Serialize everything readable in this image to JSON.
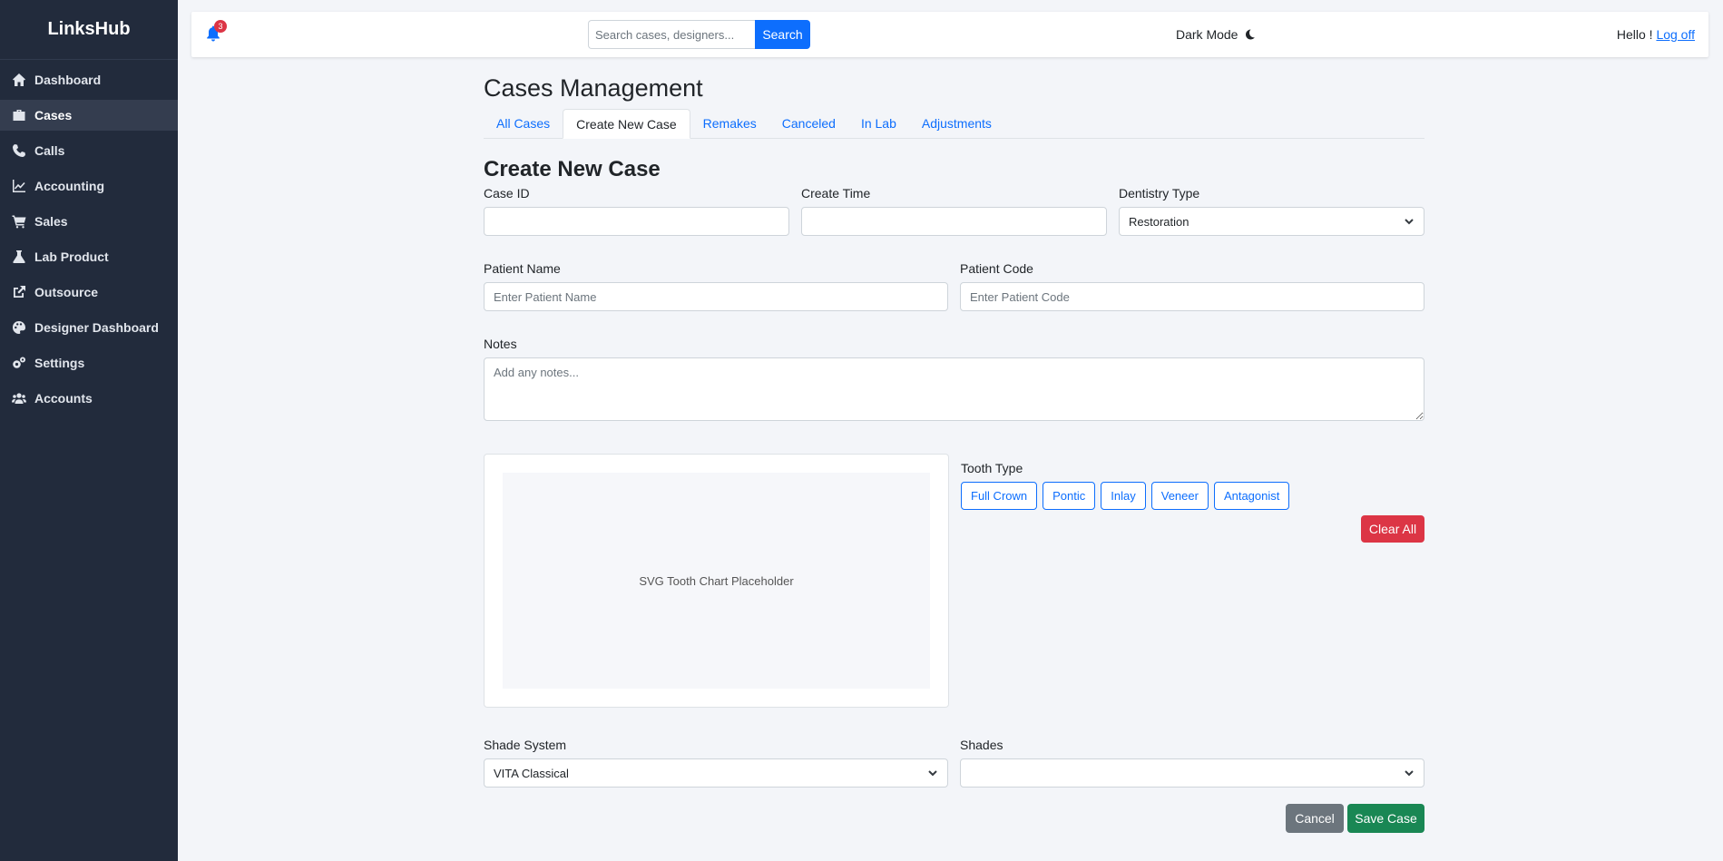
{
  "app": {
    "brand": "LinksHub"
  },
  "sidebar": {
    "items": [
      {
        "label": "Dashboard",
        "icon": "home-icon",
        "active": false
      },
      {
        "label": "Cases",
        "icon": "briefcase-icon",
        "active": true
      },
      {
        "label": "Calls",
        "icon": "phone-icon",
        "active": false
      },
      {
        "label": "Accounting",
        "icon": "chart-line-icon",
        "active": false
      },
      {
        "label": "Sales",
        "icon": "cart-icon",
        "active": false
      },
      {
        "label": "Lab Product",
        "icon": "flask-icon",
        "active": false
      },
      {
        "label": "Outsource",
        "icon": "external-link-icon",
        "active": false
      },
      {
        "label": "Designer Dashboard",
        "icon": "palette-icon",
        "active": false
      },
      {
        "label": "Settings",
        "icon": "gears-icon",
        "active": false
      },
      {
        "label": "Accounts",
        "icon": "users-icon",
        "active": false
      }
    ]
  },
  "topbar": {
    "notification_count": "3",
    "search_placeholder": "Search cases, designers...",
    "search_button": "Search",
    "dark_mode_label": "Dark Mode",
    "greeting": "Hello !",
    "logout": "Log off"
  },
  "page": {
    "title": "Cases Management",
    "tabs": [
      {
        "label": "All Cases",
        "active": false
      },
      {
        "label": "Create New Case",
        "active": true
      },
      {
        "label": "Remakes",
        "active": false
      },
      {
        "label": "Canceled",
        "active": false
      },
      {
        "label": "In Lab",
        "active": false
      },
      {
        "label": "Adjustments",
        "active": false
      }
    ]
  },
  "form": {
    "title": "Create New Case",
    "case_id": {
      "label": "Case ID",
      "value": ""
    },
    "create_time": {
      "label": "Create Time",
      "value": ""
    },
    "dentistry_type": {
      "label": "Dentistry Type",
      "value": "Restoration"
    },
    "patient_name": {
      "label": "Patient Name",
      "placeholder": "Enter Patient Name"
    },
    "patient_code": {
      "label": "Patient Code",
      "placeholder": "Enter Patient Code"
    },
    "notes": {
      "label": "Notes",
      "placeholder": "Add any notes..."
    },
    "tooth_chart_placeholder": "SVG Tooth Chart Placeholder",
    "tooth_type": {
      "label": "Tooth Type",
      "options": [
        "Full Crown",
        "Pontic",
        "Inlay",
        "Veneer",
        "Antagonist"
      ]
    },
    "clear_all": "Clear All",
    "shade_system": {
      "label": "Shade System",
      "value": "VITA Classical"
    },
    "shades": {
      "label": "Shades",
      "value": ""
    },
    "cancel": "Cancel",
    "save": "Save Case"
  },
  "colors": {
    "sidebar_bg": "#222b3c",
    "primary": "#0d6efd",
    "danger": "#dc3545",
    "success": "#198754",
    "secondary": "#6c757d"
  }
}
